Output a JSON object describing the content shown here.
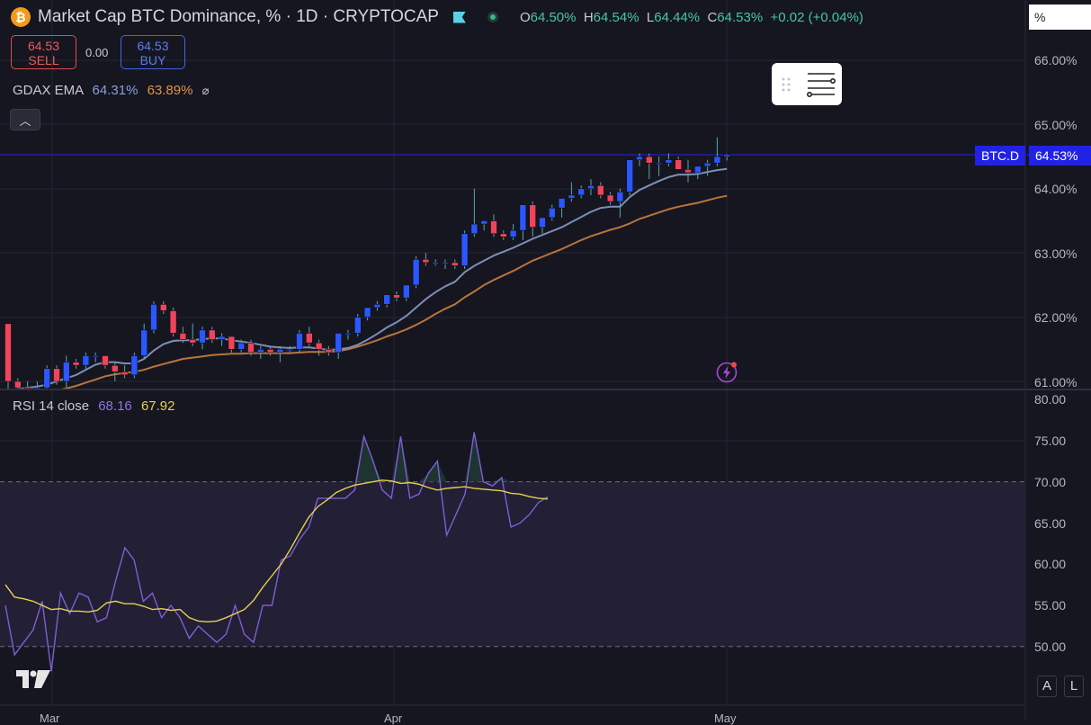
{
  "header": {
    "title": "Market Cap BTC Dominance, % · 1D · CRYPTOCAP",
    "ohlc": {
      "o_label": "O",
      "o": "64.50%",
      "h_label": "H",
      "h": "64.54%",
      "l_label": "L",
      "l": "64.44%",
      "c_label": "C",
      "c": "64.53%",
      "change": "+0.02 (+0.04%)"
    }
  },
  "trade": {
    "sell_value": "64.53",
    "sell_label": "SELL",
    "spread": "0.00",
    "buy_value": "64.53",
    "buy_label": "BUY"
  },
  "ema": {
    "label": "GDAX EMA",
    "value1": "64.31%",
    "value2": "63.89%",
    "visibility_icon": "eye-off-icon"
  },
  "rsi": {
    "label": "RSI 14 close",
    "value1": "68.16",
    "value2": "67.92"
  },
  "price_axis": {
    "unit_field": "%",
    "ticks": [
      "66.00%",
      "65.00%",
      "64.00%",
      "63.00%",
      "62.00%",
      "61.00%"
    ],
    "symbol_tag": "BTC.D",
    "price_tag": "64.53%"
  },
  "rsi_axis": {
    "ticks": [
      "80.00",
      "75.00",
      "70.00",
      "65.00",
      "60.00",
      "55.00",
      "50.00"
    ]
  },
  "x_axis": {
    "labels": [
      "Mar",
      "Apr",
      "May"
    ]
  },
  "controls": {
    "auto_label": "A",
    "log_label": "L"
  },
  "colors": {
    "up": "#2b57ff",
    "down": "#f0445a",
    "ema_fast": "#7d8fb8",
    "ema_slow": "#b9753a",
    "rsi_line": "#7d5fd6",
    "rsi_ma": "#e3d24f",
    "last_price": "#2222e6"
  },
  "chart_data": [
    {
      "type": "candlestick",
      "title": "Market Cap BTC Dominance, % · 1D · CRYPTOCAP",
      "ylim": [
        60.95,
        66.35
      ],
      "x_labels": [
        "Mar",
        "Apr",
        "May"
      ],
      "candles": [
        [
          61.9,
          61.9,
          60.85,
          61.0
        ],
        [
          61.0,
          61.05,
          60.85,
          60.9
        ],
        [
          60.9,
          61.0,
          60.8,
          60.85
        ],
        [
          60.85,
          61.0,
          60.8,
          60.9
        ],
        [
          60.9,
          61.25,
          60.85,
          61.2
        ],
        [
          61.2,
          61.25,
          60.95,
          61.0
        ],
        [
          61.0,
          61.4,
          60.9,
          61.3
        ],
        [
          61.3,
          61.35,
          61.2,
          61.25
        ],
        [
          61.25,
          61.45,
          61.2,
          61.4
        ],
        [
          61.4,
          61.45,
          61.3,
          61.4
        ],
        [
          61.4,
          61.4,
          61.2,
          61.25
        ],
        [
          61.25,
          61.3,
          61.0,
          61.15
        ],
        [
          61.15,
          61.25,
          61.05,
          61.1
        ],
        [
          61.1,
          61.45,
          61.05,
          61.4
        ],
        [
          61.4,
          61.9,
          61.35,
          61.8
        ],
        [
          61.8,
          62.25,
          61.75,
          62.2
        ],
        [
          62.2,
          62.25,
          62.05,
          62.1
        ],
        [
          62.1,
          62.15,
          61.7,
          61.75
        ],
        [
          61.75,
          61.85,
          61.6,
          61.65
        ],
        [
          61.65,
          61.9,
          61.55,
          61.6
        ],
        [
          61.6,
          61.85,
          61.5,
          61.8
        ],
        [
          61.8,
          61.85,
          61.6,
          61.65
        ],
        [
          61.65,
          61.75,
          61.55,
          61.7
        ],
        [
          61.7,
          61.7,
          61.45,
          61.5
        ],
        [
          61.5,
          61.65,
          61.45,
          61.6
        ],
        [
          61.6,
          61.65,
          61.4,
          61.45
        ],
        [
          61.45,
          61.55,
          61.35,
          61.5
        ],
        [
          61.5,
          61.55,
          61.4,
          61.45
        ],
        [
          61.45,
          61.55,
          61.3,
          61.5
        ],
        [
          61.5,
          61.55,
          61.45,
          61.5
        ],
        [
          61.5,
          61.8,
          61.45,
          61.75
        ],
        [
          61.75,
          61.85,
          61.55,
          61.6
        ],
        [
          61.6,
          61.65,
          61.4,
          61.5
        ],
        [
          61.5,
          61.55,
          61.4,
          61.45
        ],
        [
          61.45,
          61.75,
          61.35,
          61.75
        ],
        [
          61.75,
          61.8,
          61.65,
          61.75
        ],
        [
          61.75,
          62.05,
          61.7,
          62.0
        ],
        [
          62.0,
          62.15,
          61.95,
          62.15
        ],
        [
          62.15,
          62.25,
          62.1,
          62.2
        ],
        [
          62.2,
          62.35,
          62.15,
          62.35
        ],
        [
          62.35,
          62.4,
          62.25,
          62.3
        ],
        [
          62.3,
          62.5,
          62.25,
          62.5
        ],
        [
          62.5,
          62.95,
          62.45,
          62.9
        ],
        [
          62.9,
          63.0,
          62.8,
          62.85
        ],
        [
          62.85,
          62.9,
          62.8,
          62.85
        ],
        [
          62.85,
          62.9,
          62.75,
          62.85
        ],
        [
          62.85,
          62.9,
          62.75,
          62.8
        ],
        [
          62.8,
          63.35,
          62.75,
          63.3
        ],
        [
          63.3,
          64.0,
          63.25,
          63.45
        ],
        [
          63.45,
          63.5,
          63.35,
          63.5
        ],
        [
          63.5,
          63.6,
          63.25,
          63.3
        ],
        [
          63.3,
          63.35,
          63.2,
          63.25
        ],
        [
          63.25,
          63.45,
          63.2,
          63.35
        ],
        [
          63.35,
          63.75,
          63.2,
          63.75
        ],
        [
          63.75,
          63.8,
          63.25,
          63.4
        ],
        [
          63.4,
          63.55,
          63.3,
          63.55
        ],
        [
          63.55,
          63.75,
          63.5,
          63.7
        ],
        [
          63.7,
          63.85,
          63.55,
          63.85
        ],
        [
          63.85,
          64.1,
          63.8,
          63.9
        ],
        [
          63.9,
          64.05,
          63.85,
          64.0
        ],
        [
          64.0,
          64.15,
          63.9,
          64.05
        ],
        [
          64.05,
          64.1,
          63.85,
          63.9
        ],
        [
          63.9,
          63.95,
          63.75,
          63.8
        ],
        [
          63.8,
          64.0,
          63.55,
          63.95
        ],
        [
          63.95,
          64.45,
          63.9,
          64.45
        ],
        [
          64.45,
          64.55,
          64.35,
          64.5
        ],
        [
          64.5,
          64.55,
          64.15,
          64.4
        ],
        [
          64.4,
          64.5,
          64.2,
          64.4
        ],
        [
          64.4,
          64.55,
          64.35,
          64.45
        ],
        [
          64.45,
          64.5,
          64.3,
          64.3
        ],
        [
          64.3,
          64.45,
          64.1,
          64.25
        ],
        [
          64.25,
          64.35,
          64.15,
          64.35
        ],
        [
          64.35,
          64.45,
          64.2,
          64.4
        ],
        [
          64.4,
          64.8,
          64.35,
          64.5
        ],
        [
          64.5,
          64.54,
          64.44,
          64.53
        ]
      ],
      "ema_fast": [
        60.85,
        60.88,
        60.9,
        60.92,
        60.95,
        61.0,
        61.05,
        61.1,
        61.18,
        61.26,
        61.3,
        61.3,
        61.28,
        61.28,
        61.35,
        61.48,
        61.58,
        61.63,
        61.64,
        61.64,
        61.66,
        61.67,
        61.67,
        61.64,
        61.62,
        61.6,
        61.57,
        61.54,
        61.53,
        61.52,
        61.53,
        61.53,
        61.51,
        61.49,
        61.5,
        61.52,
        61.57,
        61.65,
        61.74,
        61.84,
        61.92,
        62.02,
        62.15,
        62.28,
        62.39,
        62.48,
        62.55,
        62.7,
        62.8,
        62.88,
        62.96,
        63.02,
        63.08,
        63.15,
        63.22,
        63.28,
        63.34,
        63.4,
        63.48,
        63.56,
        63.64,
        63.7,
        63.72,
        63.72,
        63.87,
        63.98,
        64.05,
        64.12,
        64.18,
        64.22,
        64.22,
        64.23,
        64.26,
        64.29,
        64.31
      ],
      "ema_slow": [
        60.7,
        60.73,
        60.76,
        60.79,
        60.82,
        60.86,
        60.89,
        60.93,
        60.98,
        61.03,
        61.08,
        61.11,
        61.13,
        61.15,
        61.18,
        61.23,
        61.27,
        61.31,
        61.35,
        61.37,
        61.39,
        61.41,
        61.42,
        61.43,
        61.43,
        61.44,
        61.44,
        61.44,
        61.44,
        61.44,
        61.45,
        61.46,
        61.46,
        61.46,
        61.47,
        61.5,
        61.54,
        61.59,
        61.64,
        61.7,
        61.75,
        61.81,
        61.88,
        61.96,
        62.05,
        62.13,
        62.2,
        62.31,
        62.4,
        62.5,
        62.58,
        62.65,
        62.72,
        62.8,
        62.88,
        62.94,
        63.0,
        63.06,
        63.13,
        63.2,
        63.26,
        63.31,
        63.36,
        63.4,
        63.46,
        63.53,
        63.58,
        63.63,
        63.68,
        63.72,
        63.75,
        63.78,
        63.82,
        63.86,
        63.89
      ]
    },
    {
      "type": "line",
      "title": "RSI 14 close",
      "ylim": [
        45.8,
        80.4
      ],
      "bands": [
        50,
        70
      ],
      "series": [
        {
          "name": "RSI 14 close",
          "values": [
            55.0,
            49.0,
            50.5,
            52.0,
            55.5,
            47.0,
            56.5,
            54.0,
            56.5,
            56.0,
            53.0,
            53.5,
            58.0,
            62.0,
            60.5,
            55.5,
            56.5,
            53.5,
            55.0,
            53.5,
            51.0,
            52.5,
            51.5,
            50.5,
            51.5,
            55.0,
            51.5,
            50.5,
            55.0,
            55.0,
            60.5,
            61.0,
            63.0,
            64.5,
            68.0,
            68.0,
            68.0,
            68.0,
            69.0,
            75.5,
            72.5,
            69.0,
            68.0,
            75.5,
            68.0,
            68.5,
            71.0,
            72.5,
            63.5,
            66.0,
            68.5,
            76.0,
            70.0,
            69.5,
            70.5,
            64.5,
            65.0,
            66.0,
            67.5,
            68.16
          ]
        },
        {
          "name": "RSI MA",
          "values": [
            57.5,
            56.0,
            55.8,
            55.5,
            55.0,
            54.5,
            54.6,
            54.3,
            54.3,
            54.2,
            54.4,
            55.3,
            55.5,
            55.2,
            55.2,
            54.9,
            54.5,
            54.6,
            54.4,
            54.5,
            53.5,
            53.1,
            53.0,
            53.1,
            53.5,
            54.0,
            54.5,
            55.6,
            57.2,
            58.6,
            60.0,
            61.8,
            63.8,
            65.7,
            67.0,
            67.8,
            68.7,
            69.2,
            69.6,
            69.8,
            70.0,
            70.2,
            70.1,
            69.8,
            69.9,
            69.7,
            69.3,
            69.0,
            69.2,
            69.3,
            69.4,
            69.2,
            69.1,
            69.0,
            68.9,
            68.6,
            68.5,
            68.2,
            68.0,
            67.92
          ]
        }
      ]
    }
  ]
}
